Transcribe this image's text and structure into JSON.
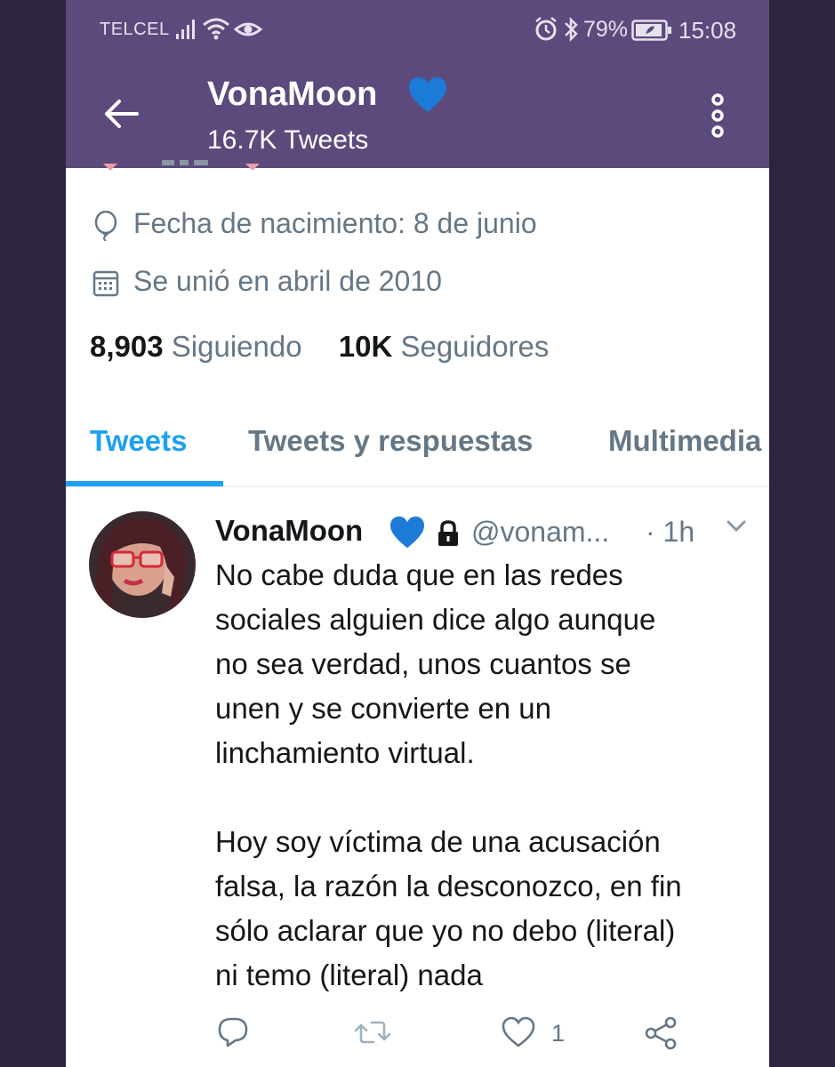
{
  "status_bar": {
    "carrier": "TELCEL",
    "battery_percent": "79%",
    "time": "15:08",
    "icons": [
      "signal-icon",
      "wifi-icon",
      "eye-icon",
      "alarm-icon",
      "bluetooth-icon",
      "battery-icon"
    ]
  },
  "header": {
    "name": "VonaMoon",
    "tweet_count": "16.7K Tweets",
    "verified_heart_color": "#1d7bd8"
  },
  "profile": {
    "birthday": "Fecha de nacimiento: 8 de junio",
    "joined": "Se unió en abril de 2010",
    "following_count": "8,903",
    "following_label": "Siguiendo",
    "followers_count": "10K",
    "followers_label": "Seguidores"
  },
  "tabs": [
    {
      "label": "Tweets",
      "active": true
    },
    {
      "label": "Tweets y respuestas",
      "active": false
    },
    {
      "label": "Multimedia",
      "active": false
    }
  ],
  "tweet": {
    "name": "VonaMoon",
    "handle": "@vonam...",
    "time": "· 1h",
    "lines": [
      "No cabe duda que en las redes",
      "sociales alguien dice algo aunque",
      "no sea verdad, unos cuantos se",
      "unen y se convierte en un",
      "linchamiento virtual.",
      "",
      "Hoy soy víctima de una acusación",
      "falsa, la razón la desconozco, en fin",
      "sólo aclarar que yo no debo (literal)",
      "ni temo (literal) nada"
    ],
    "like_count": "1"
  },
  "colors": {
    "header_bg": "#5c4a7c",
    "accent": "#1da1f2",
    "muted_text": "#657786",
    "frame_bg": "#2e2440"
  }
}
